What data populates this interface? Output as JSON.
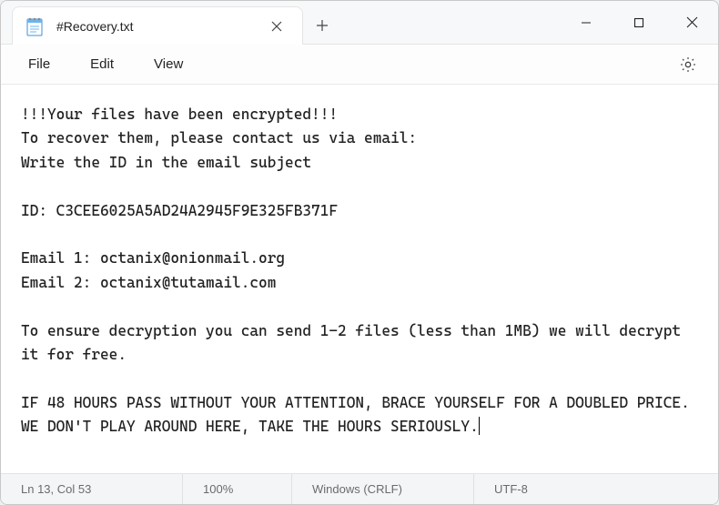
{
  "tab": {
    "title": "#Recovery.txt"
  },
  "menu": {
    "file": "File",
    "edit": "Edit",
    "view": "View"
  },
  "content": {
    "line1": "!!!Your files have been encrypted!!!",
    "line2": "To recover them, please contact us via email:",
    "line3": "Write the ID in the email subject",
    "blank1": "",
    "id_line": "ID: C3CEE6025A5AD24A2945F9E325FB371F",
    "blank2": "",
    "email1": "Email 1: octanix@onionmail.org",
    "email2": "Email 2: octanix@tutamail.com",
    "blank3": "",
    "decrypt": "To ensure decryption you can send 1-2 files (less than 1MB) we will decrypt it for free.",
    "blank4": "",
    "warn1": "IF 48 HOURS PASS WITHOUT YOUR ATTENTION, BRACE YOURSELF FOR A DOUBLED PRICE.",
    "warn2": "WE DON'T PLAY AROUND HERE, TAKE THE HOURS SERIOUSLY."
  },
  "status": {
    "position": "Ln 13, Col 53",
    "zoom": "100%",
    "eol": "Windows (CRLF)",
    "encoding": "UTF-8"
  }
}
